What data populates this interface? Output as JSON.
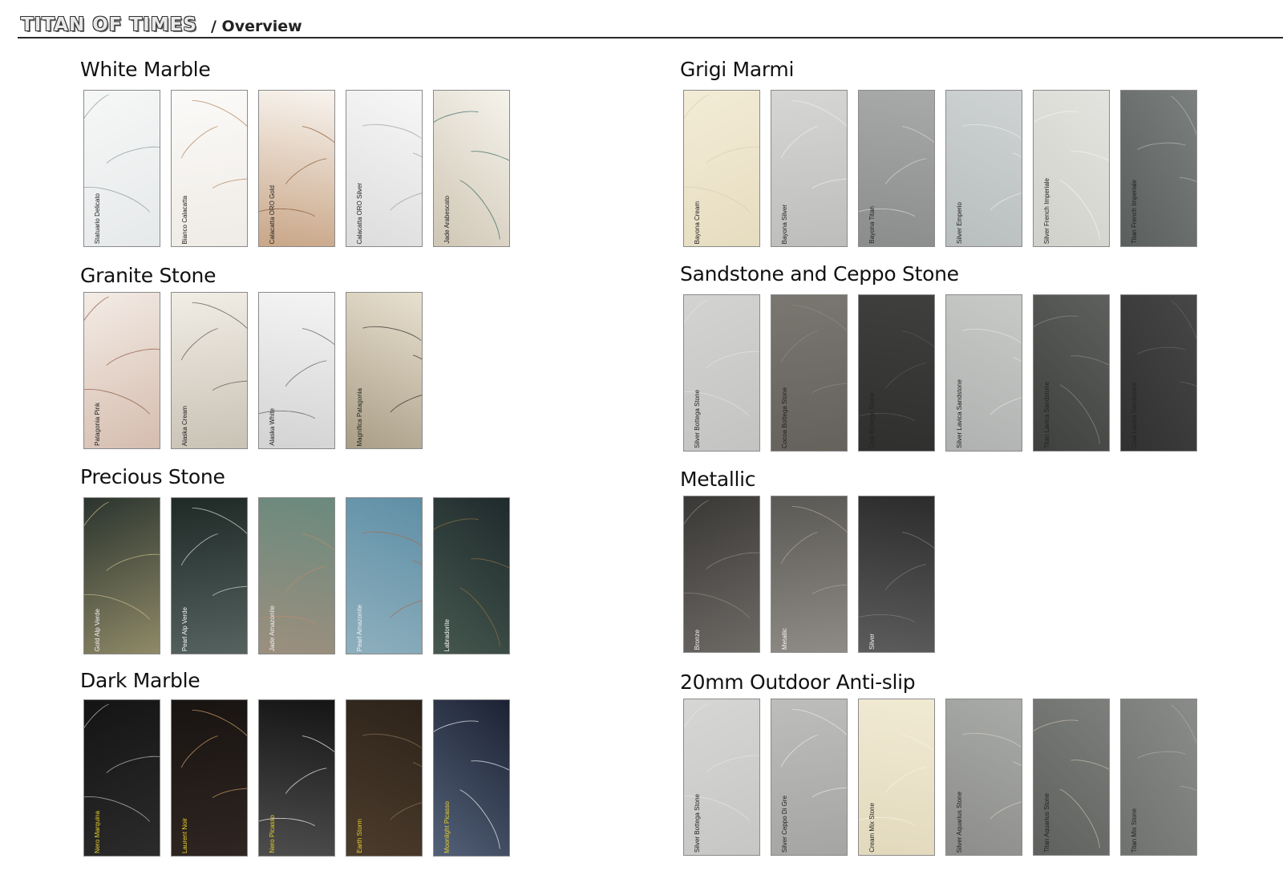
{
  "header": {
    "brand": "TITAN OF TIMES",
    "breadcrumb": "/ Overview"
  },
  "sections": {
    "white_marble": {
      "title": "White Marble",
      "tiles": [
        {
          "label": "Statuario Delicato",
          "colors": [
            "#f6f7f7",
            "#e6e9ea"
          ],
          "vein": "#8e979b",
          "label_color": "#222222"
        },
        {
          "label": "Bianco Calacatta",
          "colors": [
            "#fbfaf8",
            "#efebe6"
          ],
          "vein": "#b1845e",
          "label_color": "#222222"
        },
        {
          "label": "Calacatta ORO Gold",
          "colors": [
            "#f8f4ef",
            "#c9a687"
          ],
          "vein": "#8a5a36",
          "label_color": "#222222"
        },
        {
          "label": "Calacatta ORO Silver",
          "colors": [
            "#f7f7f7",
            "#dcdcdc"
          ],
          "vein": "#9aa0a3",
          "label_color": "#222222"
        },
        {
          "label": "Jade Arabescato",
          "colors": [
            "#f6f3ec",
            "#cfc6b4"
          ],
          "vein": "#3d6b66",
          "label_color": "#222222"
        }
      ]
    },
    "granite_stone": {
      "title": "Granite Stone",
      "tiles": [
        {
          "label": "Patagonia Pink",
          "colors": [
            "#f3ece6",
            "#d5bcae"
          ],
          "vein": "#8f5944",
          "label_color": "#222222"
        },
        {
          "label": "Alaska Cream",
          "colors": [
            "#f1ede5",
            "#c9c2b5"
          ],
          "vein": "#5c5851",
          "label_color": "#222222"
        },
        {
          "label": "Alaska White",
          "colors": [
            "#f4f4f4",
            "#d3d3d3"
          ],
          "vein": "#5e5e5e",
          "label_color": "#222222"
        },
        {
          "label": "Magnifica Patagonia",
          "colors": [
            "#e8e0cf",
            "#a99d86"
          ],
          "vein": "#33302b",
          "label_color": "#222222"
        }
      ]
    },
    "precious_stone": {
      "title": "Precious Stone",
      "tiles": [
        {
          "label": "Gold Alp Verde",
          "colors": [
            "#2b342e",
            "#8f8a68"
          ],
          "vein": "#c7bb8b",
          "label_color": "#f2f2f2"
        },
        {
          "label": "Pearl Alp Verde",
          "colors": [
            "#1f2a27",
            "#55625f"
          ],
          "vein": "#cfd6d2",
          "label_color": "#f2f2f2"
        },
        {
          "label": "Jade Amazonite",
          "colors": [
            "#6a8a7e",
            "#9c8f7e"
          ],
          "vein": "#b98d6c",
          "label_color": "#f2f2f2"
        },
        {
          "label": "Pearl Amazonite",
          "colors": [
            "#5f8fa6",
            "#8fb0be"
          ],
          "vein": "#a46d4e",
          "label_color": "#f2f2f2"
        },
        {
          "label": "Labradorite",
          "colors": [
            "#1f2a2c",
            "#46584f"
          ],
          "vein": "#8a7046",
          "label_color": "#f2f2f2"
        }
      ]
    },
    "dark_marble": {
      "title": "Dark Marble",
      "tiles": [
        {
          "label": "Nero Marquina",
          "colors": [
            "#141414",
            "#2b2b2b"
          ],
          "vein": "#bdbdbd",
          "label_color": "#e8d12a"
        },
        {
          "label": "Laurent Noir",
          "colors": [
            "#181412",
            "#2f2521"
          ],
          "vein": "#c99b61",
          "label_color": "#e8d12a"
        },
        {
          "label": "Nero Picasso",
          "colors": [
            "#151515",
            "#4d4d4d"
          ],
          "vein": "#eeeeee",
          "label_color": "#e8d12a"
        },
        {
          "label": "Earth Storm",
          "colors": [
            "#2d231a",
            "#4c3c2c"
          ],
          "vein": "#8a7258",
          "label_color": "#e8d12a"
        },
        {
          "label": "Moonlight Picasso",
          "colors": [
            "#1c2233",
            "#536178"
          ],
          "vein": "#e9ecf1",
          "label_color": "#e8d12a"
        }
      ]
    },
    "grigi_marmi": {
      "title": "Grigi Marmi",
      "tiles": [
        {
          "label": "Bayona Cream",
          "colors": [
            "#f3ecd6",
            "#e6dcc0"
          ],
          "vein": "#d9cfb4",
          "label_color": "#222222"
        },
        {
          "label": "Bayona Silver",
          "colors": [
            "#d6d6d4",
            "#bdbdbb"
          ],
          "vein": "#eeeeee",
          "label_color": "#222222"
        },
        {
          "label": "Bayona Titan",
          "colors": [
            "#a8aaaa",
            "#8b8d8d"
          ],
          "vein": "#d3d3d3",
          "label_color": "#222222"
        },
        {
          "label": "Silver Emperio",
          "colors": [
            "#cfd3d3",
            "#b8bdbd"
          ],
          "vein": "#e8ecec",
          "label_color": "#222222"
        },
        {
          "label": "Silver French Imperiale",
          "colors": [
            "#e3e3df",
            "#d0d0cb"
          ],
          "vein": "#f4f4f1",
          "label_color": "#222222"
        },
        {
          "label": "Titan French Imperiale",
          "colors": [
            "#7b7f7e",
            "#5a5e5d"
          ],
          "vein": "#b0b4b3",
          "label_color": "#222222"
        }
      ]
    },
    "sandstone_ceppo": {
      "title": "Sandstone and Ceppo Stone",
      "tiles": [
        {
          "label": "Silver Bottega Stone",
          "colors": [
            "#d3d4d2",
            "#c3c4c2"
          ],
          "vein": "#e2e3e1",
          "label_color": "#222222"
        },
        {
          "label": "Cocoa Bottega Stone",
          "colors": [
            "#7a7670",
            "#65615c"
          ],
          "vein": "#8c8882",
          "label_color": "#222222"
        },
        {
          "label": "Coal Bottega Stone",
          "colors": [
            "#3f403e",
            "#2f302e"
          ],
          "vein": "#555653",
          "label_color": "#222222"
        },
        {
          "label": "Silver Lavica Sandstone",
          "colors": [
            "#c8cac8",
            "#aeb1af"
          ],
          "vein": "#e3e4e3",
          "label_color": "#222222"
        },
        {
          "label": "Titan Lavica Sandstone",
          "colors": [
            "#5e605d",
            "#3e403d"
          ],
          "vein": "#868885",
          "label_color": "#222222"
        },
        {
          "label": "Coal Lavica Sandstone",
          "colors": [
            "#464746",
            "#2f302f"
          ],
          "vein": "#636463",
          "label_color": "#222222"
        }
      ]
    },
    "metallic": {
      "title": "Metallic",
      "tiles": [
        {
          "label": "Bronze",
          "colors": [
            "#3a3836",
            "#6d6a66"
          ],
          "vein": "#8b8782",
          "label_color": "#f2f2f2"
        },
        {
          "label": "Metallic",
          "colors": [
            "#5b5955",
            "#8e8b86"
          ],
          "vein": "#a7a39d",
          "label_color": "#f2f2f2"
        },
        {
          "label": "Silver",
          "colors": [
            "#2c2c2c",
            "#5c5c5c"
          ],
          "vein": "#7b7b7b",
          "label_color": "#f2f2f2"
        }
      ]
    },
    "outdoor_anti_slip": {
      "title": "20mm Outdoor Anti-slip",
      "tiles": [
        {
          "label": "Silver Bottega Stone",
          "colors": [
            "#d6d7d5",
            "#c6c7c5"
          ],
          "vein": "#e4e5e3",
          "label_color": "#222222"
        },
        {
          "label": "Silver Ceppo Di Gre",
          "colors": [
            "#bdbdbb",
            "#a5a5a3"
          ],
          "vein": "#e8e8e8",
          "label_color": "#222222"
        },
        {
          "label": "Cream Mix Stone",
          "colors": [
            "#f1ead3",
            "#e2d9bd"
          ],
          "vein": "#f7f2e3",
          "label_color": "#222222"
        },
        {
          "label": "Silver Aquarius Stone",
          "colors": [
            "#a9aba9",
            "#8c8d8a"
          ],
          "vein": "#d2cdc2",
          "label_color": "#222222"
        },
        {
          "label": "Titan Aquarius Stone",
          "colors": [
            "#7d7f7c",
            "#5e605d"
          ],
          "vein": "#c0b8a8",
          "label_color": "#222222"
        },
        {
          "label": "Titan Mix Stone",
          "colors": [
            "#8a8c8a",
            "#6f716f"
          ],
          "vein": "#a8aaa8",
          "label_color": "#222222"
        }
      ]
    }
  }
}
